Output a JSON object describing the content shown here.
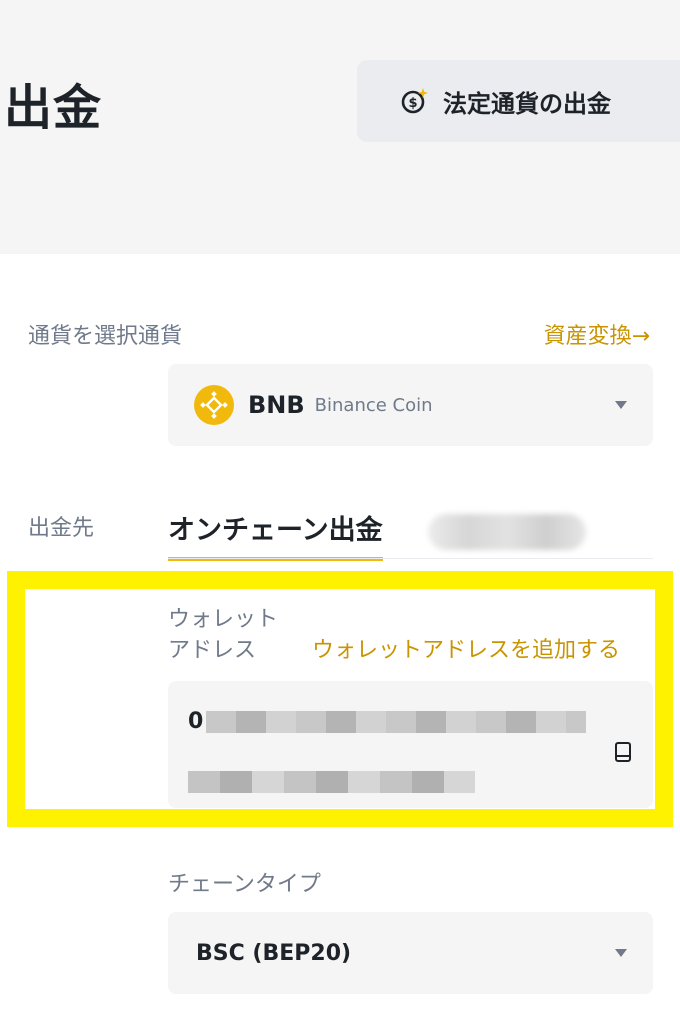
{
  "header": {
    "title": "出金",
    "fiat_button_label": "法定通貨の出金"
  },
  "coin_section": {
    "label": "通貨を選択通貨",
    "convert_link": "資産変換→",
    "selected_symbol": "BNB",
    "selected_name": "Binance Coin"
  },
  "destination": {
    "label": "出金先",
    "tabs": [
      {
        "label": "オンチェーン出金",
        "active": true
      },
      {
        "label": "",
        "active": false
      }
    ]
  },
  "wallet_address": {
    "label": "ウォレット アドレス",
    "add_link": "ウォレットアドレスを追加する",
    "value_prefix": "0"
  },
  "chain_type": {
    "label": "チェーンタイプ",
    "selected": "BSC (BEP20)"
  },
  "colors": {
    "accent": "#f0b90b",
    "link": "#c99400",
    "highlight": "#fff200",
    "panel_bg": "#f5f5f5",
    "text_secondary": "#707a8a"
  },
  "icons": {
    "fiat": "dollar-coin-sparkle-icon",
    "coin": "bnb-logo-icon",
    "address_book": "address-book-icon",
    "dropdown": "chevron-down-icon"
  }
}
